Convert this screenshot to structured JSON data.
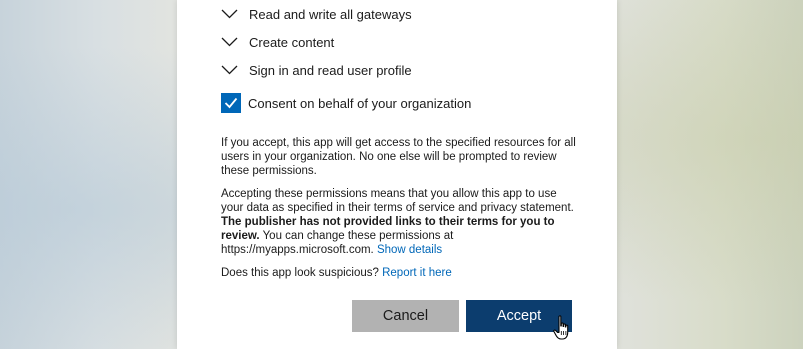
{
  "permissions": [
    {
      "label": "Read and write all gateways",
      "icon": "chevron-down-icon"
    },
    {
      "label": "Create content",
      "icon": "chevron-down-icon"
    },
    {
      "label": "Sign in and read user profile",
      "icon": "chevron-down-icon"
    }
  ],
  "consent": {
    "label": "Consent on behalf of your organization",
    "checked": true,
    "color": "#0067b8"
  },
  "info_paragraph": "If you accept, this app will get access to the specified resources for all users in your organization. No one else will be prompted to review these permissions.",
  "terms_paragraph": {
    "part1": "Accepting these permissions means that you allow this app to use your data as specified in their terms of service and privacy statement. ",
    "bold": "The publisher has not provided links to their terms for you to review.",
    "part2": " You can change these permissions at https://myapps.microsoft.com. ",
    "link": "Show details"
  },
  "suspicious": {
    "text": "Does this app look suspicious? ",
    "link": "Report it here"
  },
  "buttons": {
    "cancel": "Cancel",
    "accept": "Accept"
  },
  "colors": {
    "accent": "#0067b8",
    "accept_button": "#0c3d6e",
    "cancel_button": "#b2b2b2"
  }
}
